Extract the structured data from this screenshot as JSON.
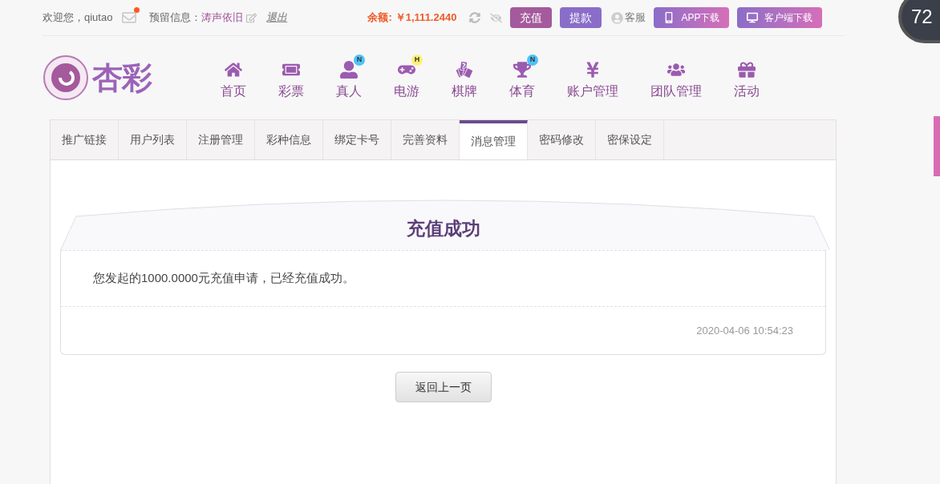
{
  "top_bar": {
    "welcome": "欢迎您，",
    "username": "qiutao",
    "has_unread_mail": true,
    "reserved_label": "预留信息：",
    "reserved_value": "涛声依旧",
    "logout": "退出",
    "balance_label": "余额:",
    "balance": "￥1,111.2440",
    "buttons": [
      {
        "label": "充值",
        "color": "#a45a9c"
      },
      {
        "label": "提款",
        "color": "#8a6dc8"
      }
    ],
    "service": "客服",
    "downloads": [
      {
        "label": "APP下载",
        "kind": "phone"
      },
      {
        "label": "客户端下载",
        "kind": "desktop"
      }
    ]
  },
  "floating_widget": {
    "value": "72"
  },
  "logo": {
    "text": "杏彩"
  },
  "nav": [
    {
      "label": "首页",
      "kind": "home"
    },
    {
      "label": "彩票",
      "kind": "ticket"
    },
    {
      "label": "真人",
      "kind": "person",
      "badge": "N",
      "color": "#4fc3f7"
    },
    {
      "label": "电游",
      "kind": "gamepad",
      "badge": "H",
      "color": "#fff176"
    },
    {
      "label": "棋牌",
      "kind": "cards"
    },
    {
      "label": "体育",
      "kind": "trophy",
      "badge": "N",
      "color": "#4fc3f7"
    },
    {
      "label": "账户管理",
      "kind": "coin"
    },
    {
      "label": "团队管理",
      "kind": "team"
    },
    {
      "label": "活动",
      "kind": "gift"
    }
  ],
  "tabs": [
    {
      "label": "推广链接",
      "selected": false
    },
    {
      "label": "用户列表",
      "selected": false
    },
    {
      "label": "注册管理",
      "selected": false
    },
    {
      "label": "彩种信息",
      "selected": false
    },
    {
      "label": "绑定卡号",
      "selected": false
    },
    {
      "label": "完善资料",
      "selected": false
    },
    {
      "label": "消息管理",
      "selected": true
    },
    {
      "label": "密码修改",
      "selected": false
    },
    {
      "label": "密保设定",
      "selected": false
    }
  ],
  "message": {
    "title": "充值成功",
    "body": "您发起的1000.0000元充值申请，已经充值成功。",
    "time": "2020-04-06 10:54:23"
  },
  "back_button": "返回上一页"
}
